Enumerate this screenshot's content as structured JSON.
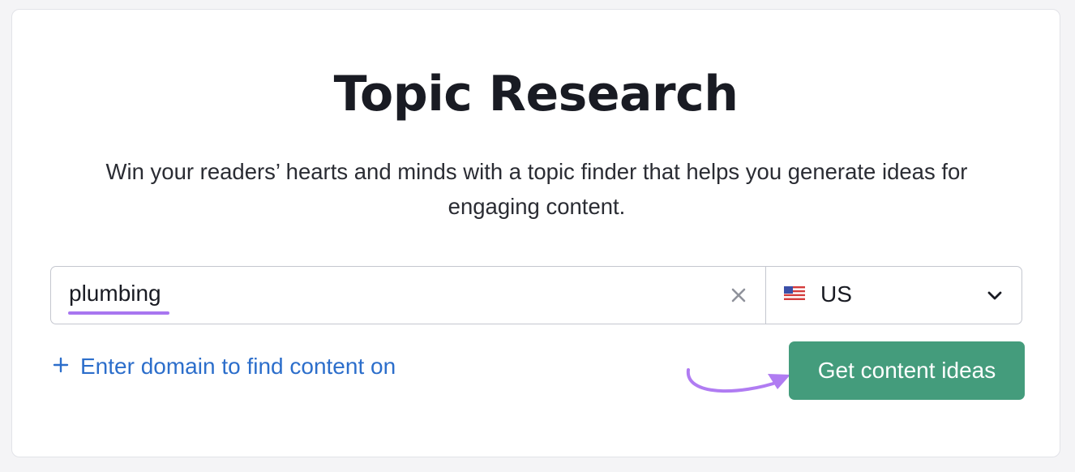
{
  "header": {
    "title": "Topic Research",
    "subtitle": "Win your readers’ hearts and minds with a topic finder that helps you generate ideas for engaging content."
  },
  "search": {
    "keyword_value": "plumbing",
    "clear_icon": "close-icon"
  },
  "country": {
    "selected": "US",
    "flag_icon": "us-flag-icon",
    "dropdown_icon": "chevron-down-icon"
  },
  "domain_link": {
    "icon": "plus-icon",
    "label": "Enter domain to find content on"
  },
  "cta": {
    "label": "Get content ideas"
  },
  "colors": {
    "page_background": "#f4f4f6",
    "card_background": "#ffffff",
    "title_text": "#191b23",
    "link": "#2c6ecb",
    "cta_button": "#449c7c",
    "highlight_underline": "#a876f0",
    "arrow": "#b07cf2"
  }
}
